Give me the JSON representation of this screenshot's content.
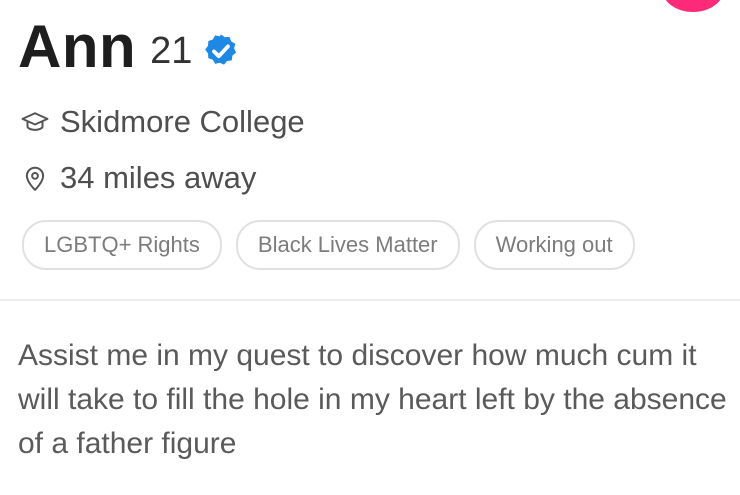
{
  "profile": {
    "name": "Ann",
    "age": "21",
    "verified_icon": "verified-badge-icon",
    "school": "Skidmore College",
    "school_icon": "graduation-cap-icon",
    "distance": "34 miles away",
    "distance_icon": "location-pin-icon"
  },
  "interests": [
    "LGBTQ+ Rights",
    "Black Lives Matter",
    "Working out"
  ],
  "bio": "Assist me in my quest to discover how much cum it will take to fill the hole in my heart left by the absence of a father figure",
  "colors": {
    "accent_pink": "#fd2a79",
    "verified_blue": "#1e88e5",
    "text_primary": "#1e1e1e",
    "text_secondary": "#5a5a5a"
  }
}
